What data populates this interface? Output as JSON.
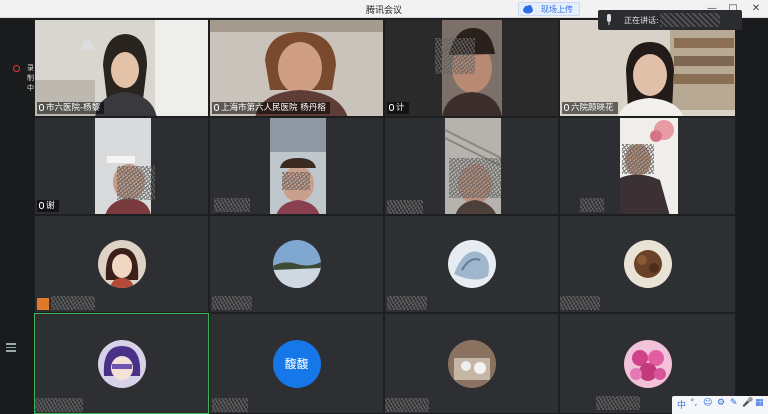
{
  "window": {
    "title": "腾讯会议",
    "upload_label": "现场上传"
  },
  "speaking": {
    "label": "正在讲话:"
  },
  "recording": {
    "label": "录制中"
  },
  "tray": {
    "items": [
      "中",
      "°,",
      "☺",
      "⚙",
      "✎",
      "🎤",
      "▦"
    ]
  },
  "tiles": [
    {
      "id": "t1",
      "name": "市六医院-杨黎"
    },
    {
      "id": "t2",
      "name": "上海市第六人民医院 杨丹榕"
    },
    {
      "id": "t3",
      "name": "计"
    },
    {
      "id": "t4",
      "name": "六院顾晓花"
    },
    {
      "id": "t5",
      "name": "谢"
    },
    {
      "id": "t14",
      "avatar_text": "馥馥"
    }
  ]
}
